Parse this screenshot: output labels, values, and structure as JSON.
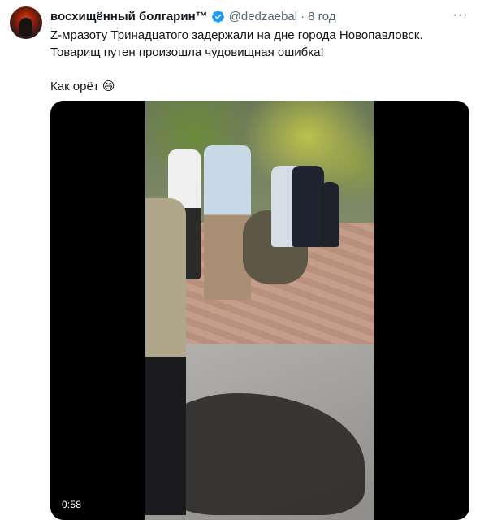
{
  "tweet": {
    "author_name": "восхищённый болгарин™",
    "handle": "@dedzaebal",
    "separator": "·",
    "time": "8 год",
    "more_label": "···",
    "text_line1": "Z-мразоту Тринадцатого задержали на дне города Новопавловск.",
    "text_line2": "Товарищ путен произошла чудовищная ошибка!",
    "text_line3": "Как орёт 😄"
  },
  "media": {
    "duration": "0:58"
  },
  "colors": {
    "text": "#0f1419",
    "secondary": "#536471",
    "verified": "#1d9bf0",
    "media_bg": "#000000"
  },
  "icons": {
    "verified": "verified-badge-icon",
    "more": "more-horizontal-icon"
  }
}
